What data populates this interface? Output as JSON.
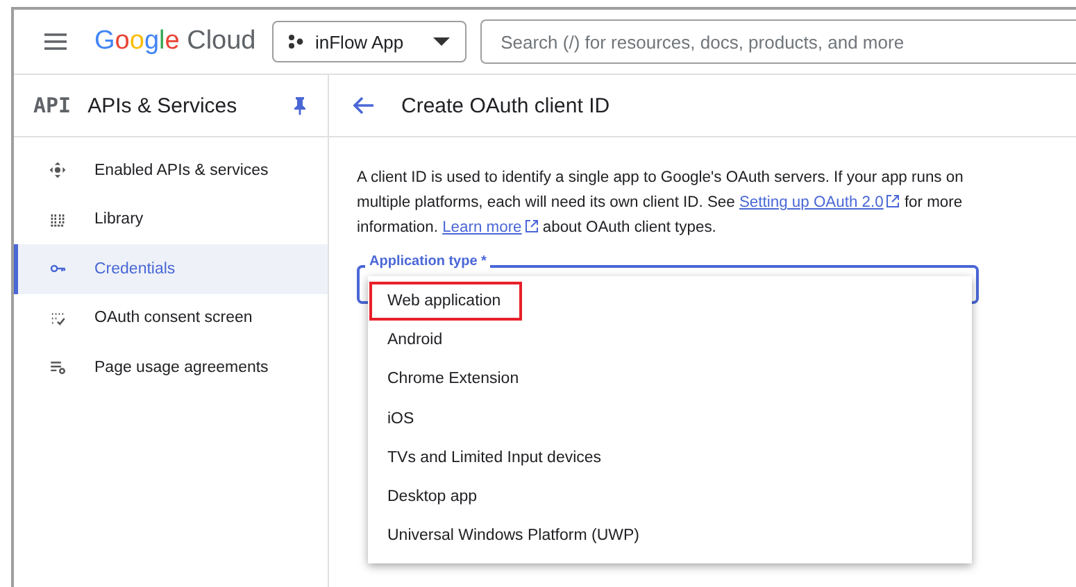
{
  "top_bar": {
    "logo": {
      "brand": "Google",
      "product": "Cloud"
    },
    "project": "inFlow App",
    "search": {
      "placeholder": "Search (/) for resources, docs, products, and more"
    }
  },
  "sidebar": {
    "badge": "API",
    "title": "APIs & Services",
    "pinned": true,
    "items": [
      {
        "label": "Enabled APIs & services",
        "kind": "move",
        "selected": false
      },
      {
        "label": "Library",
        "kind": "library",
        "selected": false
      },
      {
        "label": "Credentials",
        "kind": "key",
        "selected": true
      },
      {
        "label": "OAuth consent screen",
        "kind": "consent",
        "selected": false
      },
      {
        "label": "Page usage agreements",
        "kind": "agreements",
        "selected": false
      }
    ]
  },
  "page": {
    "title": "Create OAuth client ID",
    "description": [
      {
        "kind": "text",
        "text": "A client ID is used to identify a single app to Google's OAuth servers. If your app runs on multiple platforms, each will need its own client ID. See "
      },
      {
        "kind": "link",
        "text": "Setting up OAuth 2.0"
      },
      {
        "kind": "text",
        "text": " for more information. "
      },
      {
        "kind": "link",
        "text": "Learn more"
      },
      {
        "kind": "text",
        "text": " about OAuth client types."
      }
    ],
    "application_type": {
      "label": "Application type *",
      "options": [
        {
          "label": "Web application",
          "highlighted": true
        },
        {
          "label": "Android",
          "highlighted": false
        },
        {
          "label": "Chrome Extension",
          "highlighted": false
        },
        {
          "label": "iOS",
          "highlighted": false
        },
        {
          "label": "TVs and Limited Input devices",
          "highlighted": false
        },
        {
          "label": "Desktop app",
          "highlighted": false
        },
        {
          "label": "Universal Windows Platform (UWP)",
          "highlighted": false
        }
      ]
    }
  }
}
